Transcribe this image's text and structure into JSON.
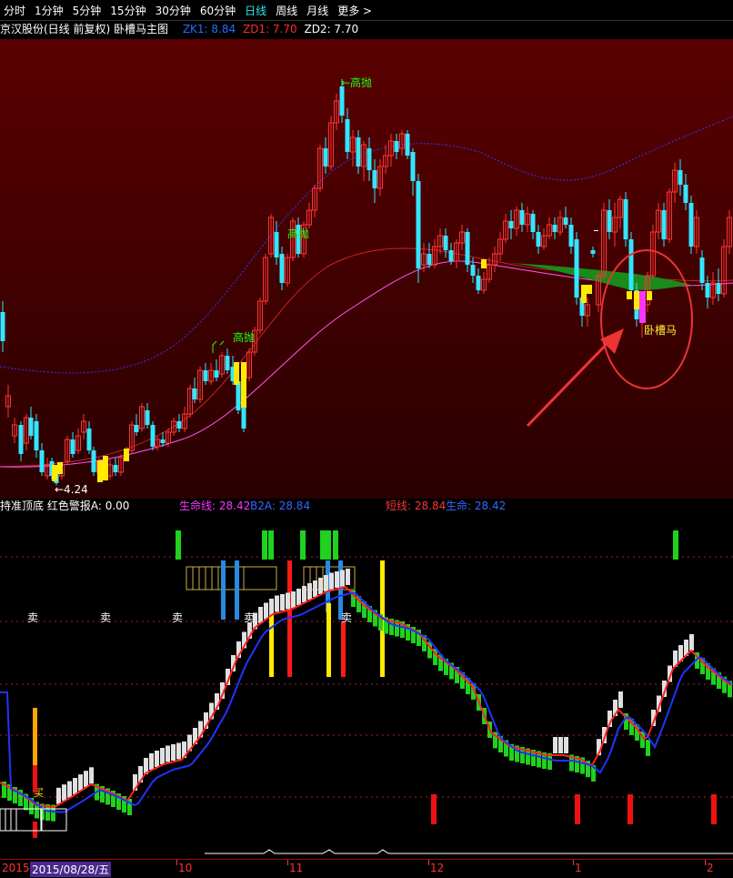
{
  "toolbar": {
    "items": [
      "分时",
      "1分钟",
      "5分钟",
      "15分钟",
      "30分钟",
      "60分钟",
      "日线",
      "周线",
      "月线",
      "更多 >"
    ],
    "active_index": 6,
    "active_color": "#2ee6e6"
  },
  "main_title": {
    "name": "京汉股份(日线 前复权) 卧槽马主图",
    "zk1_label": "ZK1: 8.84",
    "zd1_label": "ZD1: 7.70",
    "zd2_label": "ZD2: 7.70",
    "zk1_color": "#1e6fff",
    "zd1_color": "#ff2a2a",
    "zd2_color": "#ffffff"
  },
  "main_annotations": {
    "high_sell_top": "←高抛",
    "high_sell_mid": "高抛",
    "high_sell_low": "高抛",
    "low_price": "←4.24",
    "woca_label": "卧槽马",
    "label_color": "#18ff18",
    "woca_color": "#ffee33"
  },
  "sub_title": {
    "name": "持准顶底",
    "alert_label": "红色警报A: 0.00",
    "life_line": "生命线: 28.42",
    "b2a": "B2A: 28.84",
    "short_line": "短线: 28.84",
    "life": "生命: 28.42"
  },
  "sell_labels": [
    "卖",
    "卖",
    "卖",
    "卖",
    "卖"
  ],
  "buy_label": "买",
  "axis": {
    "start_year": "2015",
    "cursor_date": "2015/08/28/五",
    "months": [
      "10",
      "11",
      "12",
      "1",
      "2"
    ]
  },
  "colors": {
    "up": "#ff3333",
    "down": "#33e6ff",
    "green": "#1ed21e",
    "yellow": "#ffea00",
    "magenta": "#ff33ff",
    "blue_line": "#2233ff"
  }
}
